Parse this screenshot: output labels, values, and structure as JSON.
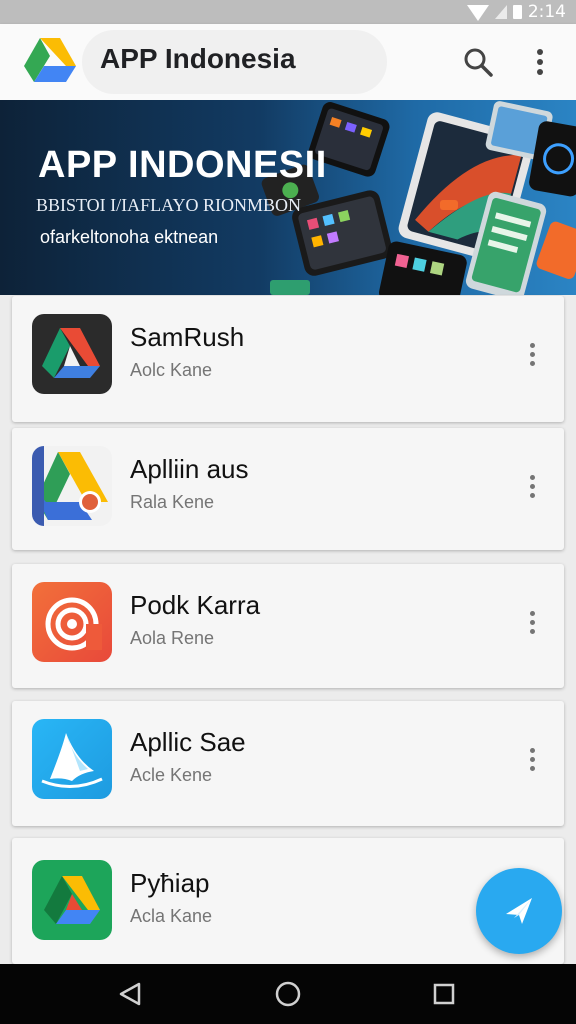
{
  "status_bar": {
    "time": "2:14"
  },
  "app_bar": {
    "title": "APP Indonesia"
  },
  "banner": {
    "title": "APP INDONESII",
    "subtitle_1": "BBISTOI I/IAFLAYO RIONMBON",
    "subtitle_2": "ofarkeltonoha ektnean"
  },
  "apps": [
    {
      "name": "SamRush",
      "subtitle": "Aolc Kane",
      "icon": "drive-dark-icon"
    },
    {
      "name": "Aplliin aus",
      "subtitle": "Rala Kene",
      "icon": "drive-badge-icon"
    },
    {
      "name": "Podk Karra",
      "subtitle": "Aola Rene",
      "icon": "broadcast-icon"
    },
    {
      "name": "Apllic Sae",
      "subtitle": "Acle Kene",
      "icon": "shark-fin-icon"
    },
    {
      "name": "Pyħiap",
      "subtitle": "Acla Kane",
      "icon": "drive-green-icon"
    }
  ],
  "icons": {
    "search": "search-icon",
    "more": "more-vert-icon",
    "fab": "send-icon",
    "nav": [
      "back-icon",
      "home-icon",
      "recents-icon"
    ]
  },
  "colors": {
    "fab": "#29a9f0",
    "banner": "#123b63",
    "navbar": "#050505"
  }
}
